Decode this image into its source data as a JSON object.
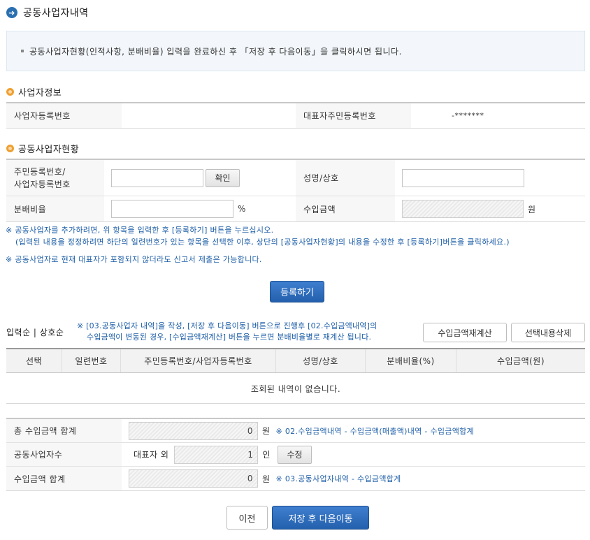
{
  "page_title": "공동사업자내역",
  "notice": "공동사업자현황(인적사항, 분배비율) 입력을 완료하신 후 「저장 후 다음이동」을 클릭하시면 됩니다.",
  "business_info": {
    "section_title": "사업자정보",
    "reg_no_label": "사업자등록번호",
    "reg_no_value": "",
    "rep_id_label": "대표자주민등록번호",
    "rep_id_value": "-*******"
  },
  "partner_status": {
    "section_title": "공동사업자현황",
    "id_label_line1": "주민등록번호/",
    "id_label_line2": "사업자등록번호",
    "id_input_value": "",
    "confirm_button": "확인",
    "name_label": "성명/상호",
    "name_input_value": "",
    "ratio_label": "분배비율",
    "ratio_input_value": "",
    "ratio_unit": "%",
    "income_label": "수입금액",
    "income_unit": "원"
  },
  "notes": {
    "line1": "※ 공동사업자를 추가하려면, 위 항목을 입력한 후 [등록하기] 버튼을 누르십시오.",
    "line2": "(입력된 내용을 정정하려면 하단의 일련번호가 있는 항목을 선택한 이후, 상단의 [공동사업자현황]의 내용을 수정한 후 [등록하기]버튼을 클릭하세요.)",
    "line3": "※ 공동사업자로 현재 대표자가 포함되지 않더라도 신고서 제출은 가능합니다."
  },
  "register_button": "등록하기",
  "list_area": {
    "sort_label": "입력순 | 상호순",
    "info_line1": "※ [03.공동사업자 내역]을 작성, [저장 후 다음이동] 버튼으로 진행후 [02.수입금액내역]의",
    "info_line2": "수입금액이 변동된 경우, [수입금액재계산] 버튼을 누르면 분배비율별로 재계산 됩니다.",
    "recalc_button": "수입금액재계산",
    "delete_button": "선택내용삭제",
    "columns": [
      "선택",
      "일련번호",
      "주민등록번호/사업자등록번호",
      "성명/상호",
      "분배비율(%)",
      "수입금액(원)"
    ],
    "empty_message": "조회된 내역이 없습니다."
  },
  "summary": {
    "total_income_label": "총 수입금액 합계",
    "total_income_value": "0",
    "total_income_unit": "원",
    "total_income_note": "※ 02.수입금액내역 - 수입금액(매출액)내역 - 수입금액합계",
    "partner_count_label": "공동사업자수",
    "partner_count_prefix": "대표자 외",
    "partner_count_value": "1",
    "partner_count_unit": "인",
    "modify_button": "수정",
    "income_sum_label": "수입금액 합계",
    "income_sum_value": "0",
    "income_sum_unit": "원",
    "income_sum_note": "※ 03.공동사업자내역 - 수입금액합계"
  },
  "footer": {
    "prev_button": "이전",
    "save_next_button": "저장 후 다음이동"
  }
}
